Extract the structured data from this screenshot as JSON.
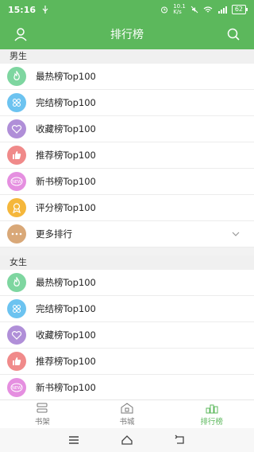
{
  "status": {
    "time": "15:16",
    "net_speed": "10.1\nK/s",
    "battery": "62"
  },
  "appbar": {
    "title": "排行榜"
  },
  "sections": [
    {
      "title": "男生",
      "items": [
        {
          "label": "最热榜Top100",
          "icon": "flame-icon",
          "color": "#7ed6a0"
        },
        {
          "label": "完结榜Top100",
          "icon": "grid-icon",
          "color": "#6cc3f0"
        },
        {
          "label": "收藏榜Top100",
          "icon": "heart-icon",
          "color": "#b08fd8"
        },
        {
          "label": "推荐榜Top100",
          "icon": "thumbs-up-icon",
          "color": "#f08a8a"
        },
        {
          "label": "新书榜Top100",
          "icon": "new-badge-icon",
          "color": "#e58fe0"
        },
        {
          "label": "评分榜Top100",
          "icon": "award-icon",
          "color": "#f5b73b"
        },
        {
          "label": "更多排行",
          "icon": "more-dots-icon",
          "color": "#d9a878"
        }
      ]
    },
    {
      "title": "女生",
      "items": [
        {
          "label": "最热榜Top100",
          "icon": "flame-icon",
          "color": "#7ed6a0"
        },
        {
          "label": "完结榜Top100",
          "icon": "grid-icon",
          "color": "#6cc3f0"
        },
        {
          "label": "收藏榜Top100",
          "icon": "heart-icon",
          "color": "#b08fd8"
        },
        {
          "label": "推荐榜Top100",
          "icon": "thumbs-up-icon",
          "color": "#f08a8a"
        },
        {
          "label": "新书榜Top100",
          "icon": "new-badge-icon",
          "color": "#e58fe0"
        }
      ]
    }
  ],
  "tabs": [
    {
      "label": "书架",
      "icon": "bookshelf-icon",
      "active": false
    },
    {
      "label": "书城",
      "icon": "bookstore-icon",
      "active": false
    },
    {
      "label": "排行榜",
      "icon": "ranking-icon",
      "active": true
    }
  ],
  "colors": {
    "accent": "#5cb85c"
  }
}
